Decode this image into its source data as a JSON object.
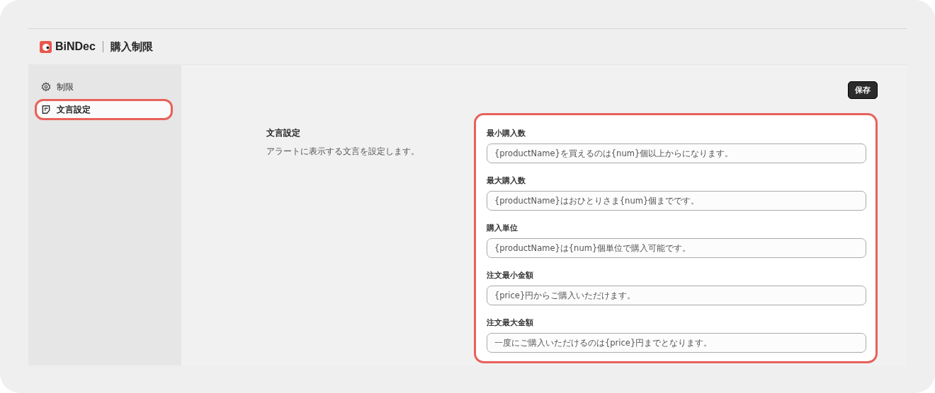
{
  "header": {
    "brand": "BiNDec",
    "title": "購入制限"
  },
  "sidebar": {
    "items": [
      {
        "label": "制限",
        "kind": "gear",
        "selected": false
      },
      {
        "label": "文言設定",
        "kind": "note",
        "selected": true
      }
    ]
  },
  "save_button": "保存",
  "section": {
    "title": "文言設定",
    "description": "アラートに表示する文言を設定します。"
  },
  "fields": [
    {
      "label": "最小購入数",
      "value": "{productName}を買えるのは{num}個以上からになります。"
    },
    {
      "label": "最大購入数",
      "value": "{productName}はおひとりさま{num}個までです。"
    },
    {
      "label": "購入単位",
      "value": "{productName}は{num}個単位で購入可能です。"
    },
    {
      "label": "注文最小金額",
      "value": "{price}円からご購入いただけます。"
    },
    {
      "label": "注文最大金額",
      "value": "一度にご購入いただけるのは{price}円までとなります。"
    }
  ]
}
